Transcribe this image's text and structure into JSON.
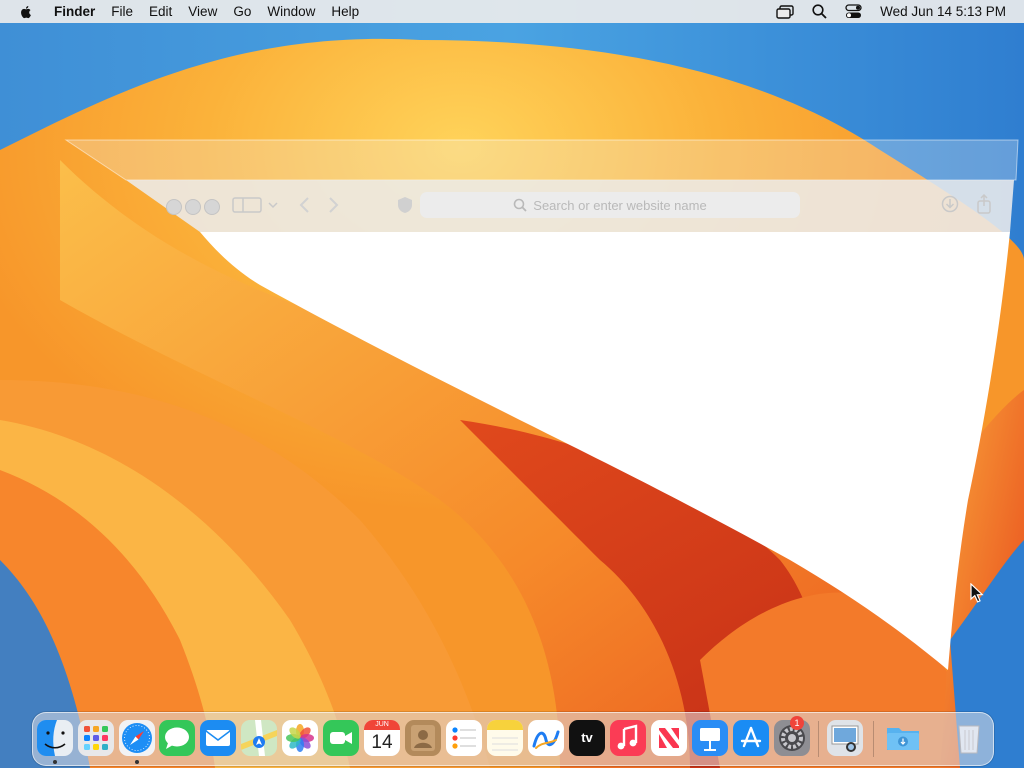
{
  "menubar": {
    "app_name": "Finder",
    "menus": [
      "File",
      "Edit",
      "View",
      "Go",
      "Window",
      "Help"
    ],
    "clock": "Wed Jun 14  5:13 PM",
    "status_icons": [
      "screen-mirroring-icon",
      "spotlight-search-icon",
      "control-center-icon"
    ]
  },
  "safari": {
    "search_placeholder": "Search or enter website name"
  },
  "dock": {
    "apps": [
      {
        "name": "Finder",
        "running": true
      },
      {
        "name": "Launchpad",
        "running": false
      },
      {
        "name": "Safari",
        "running": true
      },
      {
        "name": "Messages",
        "running": false
      },
      {
        "name": "Mail",
        "running": false
      },
      {
        "name": "Maps",
        "running": false
      },
      {
        "name": "Photos",
        "running": false
      },
      {
        "name": "FaceTime",
        "running": false
      },
      {
        "name": "Calendar",
        "running": false
      },
      {
        "name": "Contacts",
        "running": false
      },
      {
        "name": "Reminders",
        "running": false
      },
      {
        "name": "Notes",
        "running": false
      },
      {
        "name": "Freeform",
        "running": false
      },
      {
        "name": "TV",
        "running": false
      },
      {
        "name": "Music",
        "running": false
      },
      {
        "name": "News",
        "running": false
      },
      {
        "name": "Keynote",
        "running": false
      },
      {
        "name": "App Store",
        "running": false
      },
      {
        "name": "System Settings",
        "running": false
      },
      {
        "name": "Preview",
        "running": false
      },
      {
        "name": "Downloads",
        "running": false
      },
      {
        "name": "Trash",
        "running": false
      }
    ],
    "calendar_month": "JUN",
    "calendar_day": "14",
    "tv_label": "tv",
    "settings_badge": "1"
  }
}
